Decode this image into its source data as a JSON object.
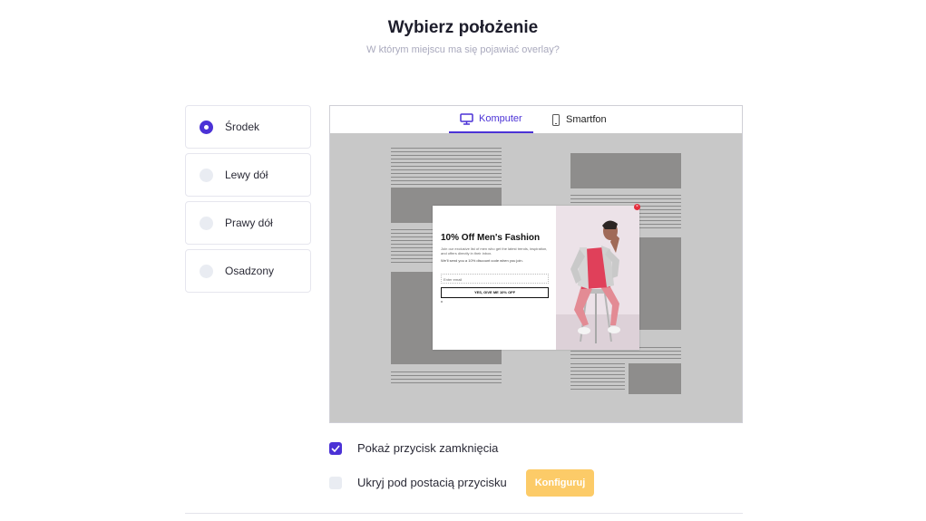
{
  "header": {
    "title": "Wybierz położenie",
    "subtitle": "W którym miejscu ma się pojawiać overlay?"
  },
  "positions": {
    "selected": "Środek",
    "items": [
      {
        "label": "Środek",
        "checked": true
      },
      {
        "label": "Lewy dół",
        "checked": false
      },
      {
        "label": "Prawy dół",
        "checked": false
      },
      {
        "label": "Osadzony",
        "checked": false
      }
    ]
  },
  "preview": {
    "tabs": [
      {
        "label": "Komputer",
        "icon": "desktop-icon",
        "active": true
      },
      {
        "label": "Smartfon",
        "icon": "smartphone-icon",
        "active": false
      }
    ],
    "popup": {
      "heading": "10% Off Men's Fashion",
      "text": "Join our exclusive list of men who get the latest trends, inspiration, and offers directly in their inbox.",
      "text2": "We'll send you a 10% discount code when you join.",
      "input_placeholder": "Enter email",
      "button": "YES, GIVE ME 10% OFF"
    }
  },
  "options": {
    "show_close": {
      "label": "Pokaż przycisk zamknięcia",
      "checked": true
    },
    "hide_as_button": {
      "label": "Ukryj pod postacią przycisku",
      "checked": false
    },
    "configure_button": "Konfiguruj"
  },
  "colors": {
    "accent": "#4b32d6",
    "configure": "#fccb68",
    "canvas": "#c8c8c8",
    "block": "#8e8d8c"
  }
}
